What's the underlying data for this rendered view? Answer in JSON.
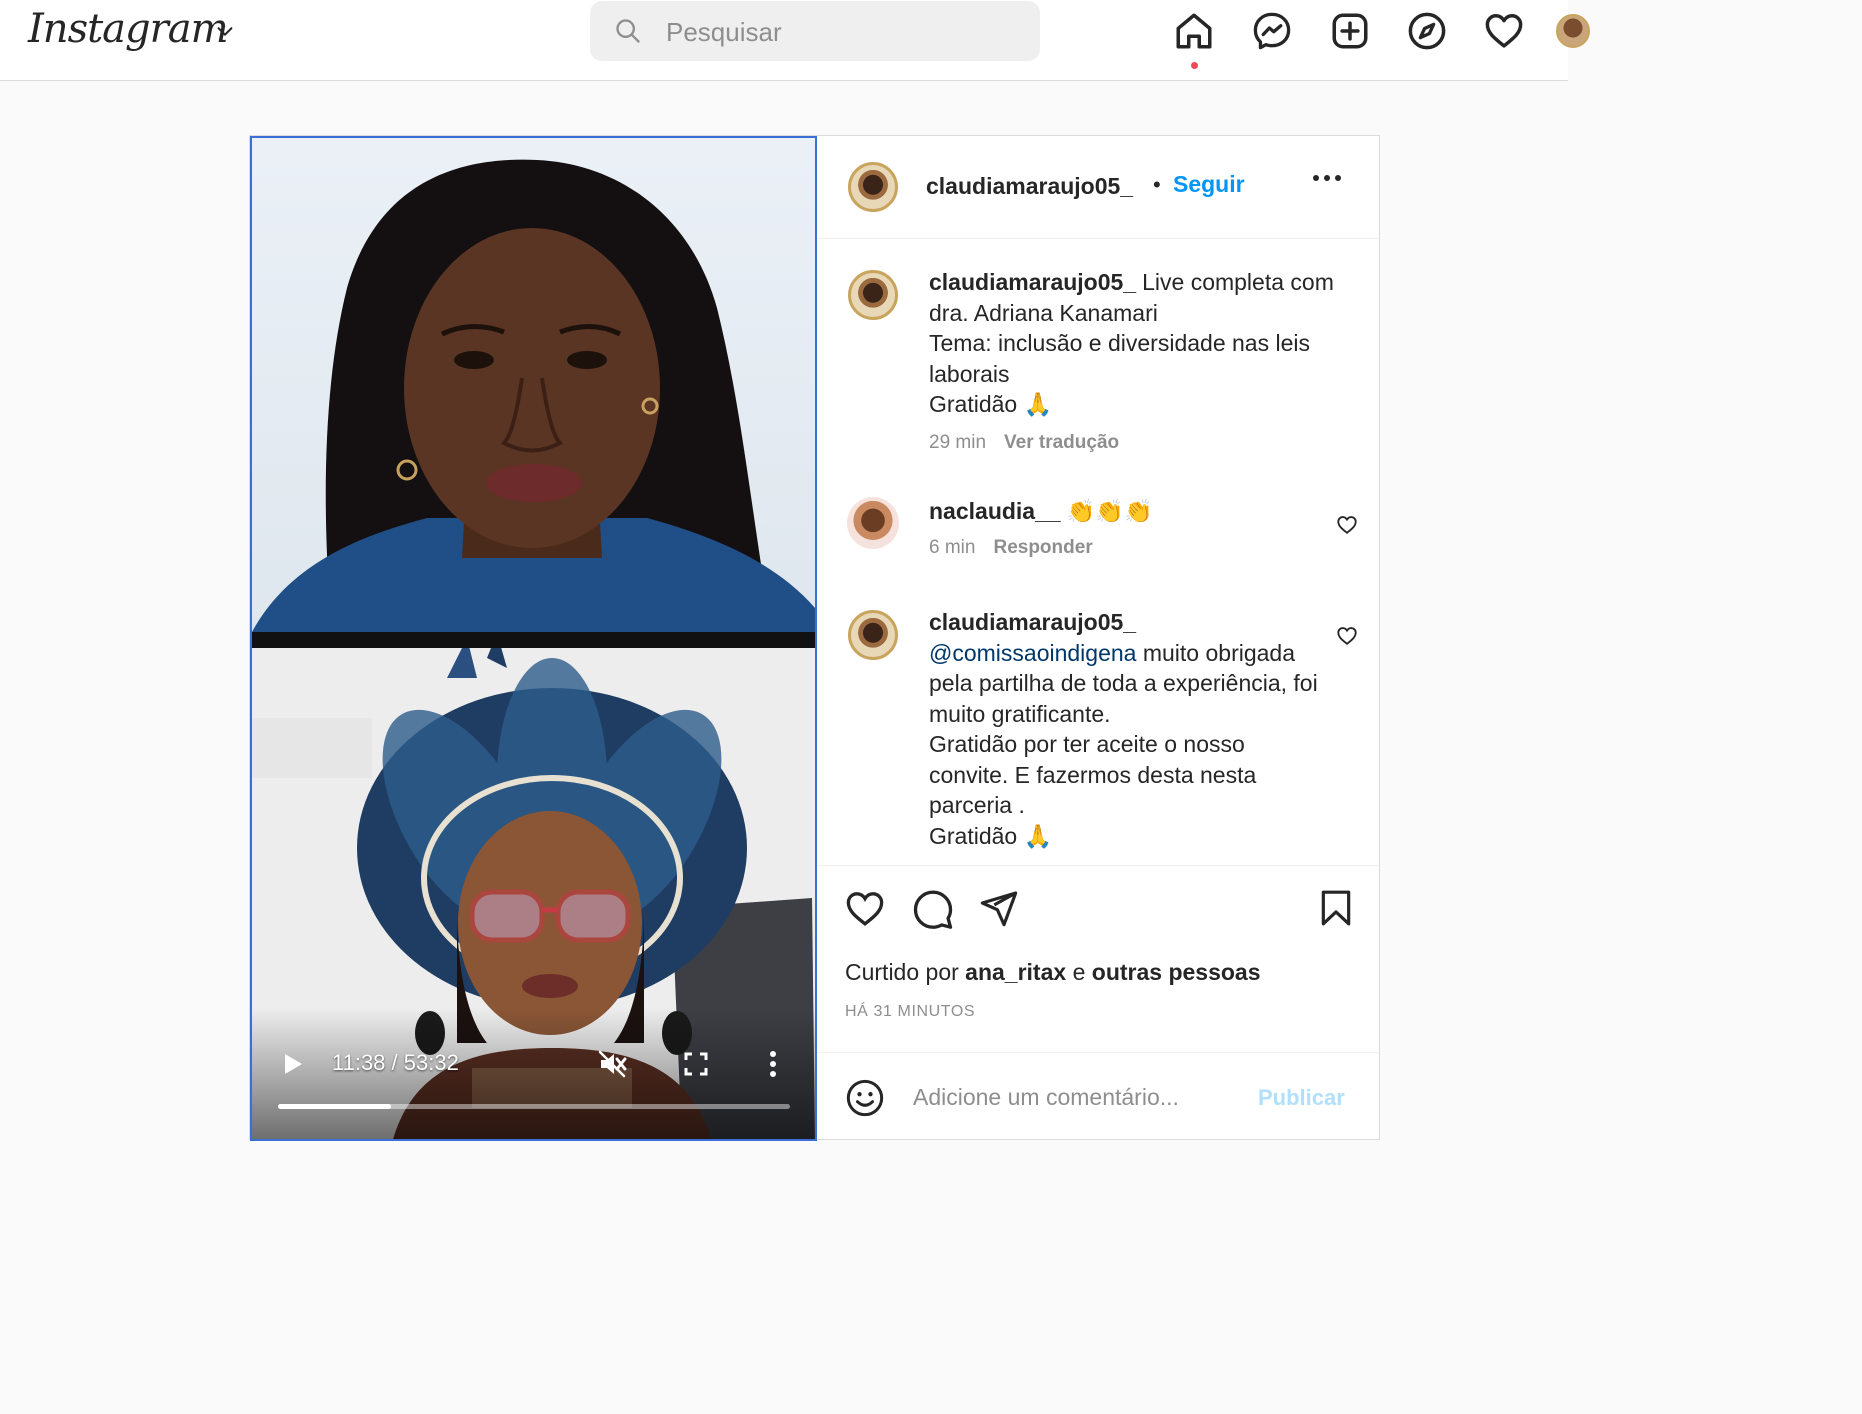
{
  "nav": {
    "logo": "Instagram",
    "search_placeholder": "Pesquisar",
    "icons": [
      "home-icon",
      "messenger-icon",
      "new-post-icon",
      "explore-icon",
      "activity-heart-icon",
      "profile-avatar"
    ],
    "notification_color": "#ed4956"
  },
  "post": {
    "author": "claudiamaraujo05_",
    "separator": "•",
    "follow_label": "Seguir",
    "more_label": "...",
    "video": {
      "time": "11:38 / 53:32",
      "progress": 0.22,
      "icons": [
        "play-icon",
        "mute-icon",
        "fullscreen-icon",
        "more-vertical-icon"
      ]
    },
    "caption": {
      "user": "claudiamaraujo05_",
      "lines": [
        "Live completa com dra. Adriana Kanamari",
        "Tema: inclusão e diversidade nas leis laborais",
        "Gratidão 🙏"
      ],
      "time": "29 min",
      "translate_label": "Ver tradução"
    },
    "comments": [
      {
        "user": "naclaudia__",
        "text": "👏👏👏",
        "time": "6 min",
        "reply_label": "Responder"
      },
      {
        "user": "claudiamaraujo05_",
        "mention": "@comissaoindigena",
        "text": "muito obrigada pela partilha de toda a experiência, foi muito gratificante.",
        "line2": "Gratidão por ter aceite o nosso convite. E fazermos desta nesta parceria .",
        "line3": "Gratidão 🙏"
      }
    ],
    "liked_by_prefix": "Curtido por",
    "liked_by_user": "ana_ritax",
    "liked_by_and": "e",
    "liked_by_others": "outras pessoas",
    "posted_ago": "HÁ 31 MINUTOS",
    "add_comment_placeholder": "Adicione um comentário...",
    "publish_label": "Publicar",
    "accent_color": "#0095f6"
  }
}
